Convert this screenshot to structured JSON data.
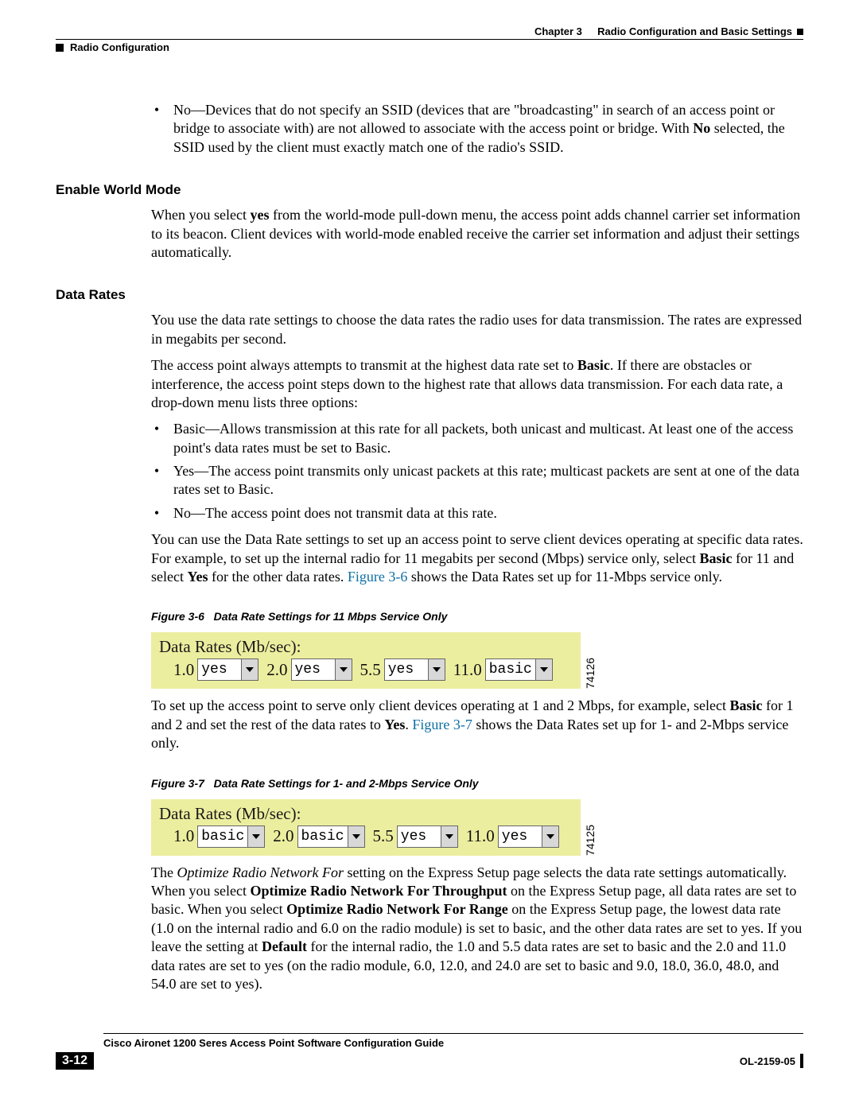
{
  "header": {
    "chapter_label": "Chapter 3",
    "chapter_title": "Radio Configuration and Basic Settings",
    "section_title": "Radio Configuration"
  },
  "intro_bullet": {
    "lead": "No—Devices that do not specify an SSID (devices that are \"broadcasting\" in search of an access point or bridge to associate with) are not allowed to associate with the access point or bridge. With ",
    "bold": "No",
    "tail": " selected, the SSID used by the client must exactly match one of the radio's SSID."
  },
  "sections": {
    "world_mode": {
      "heading": "Enable World Mode",
      "para": {
        "pre": "When you select ",
        "b1": "yes",
        "post": " from the world-mode pull-down menu, the access point adds channel carrier set information to its beacon. Client devices with world-mode enabled receive the carrier set information and adjust their settings automatically."
      }
    },
    "data_rates": {
      "heading": "Data Rates",
      "p1": "You use the data rate settings to choose the data rates the radio uses for data transmission. The rates are expressed in megabits per second.",
      "p2": {
        "pre": "The access point always attempts to transmit at the highest data rate set to ",
        "b": "Basic",
        "post": ". If there are obstacles or interference, the access point steps down to the highest rate that allows data transmission. For each data rate, a drop-down menu lists three options:"
      },
      "bullets": [
        "Basic—Allows transmission at this rate for all packets, both unicast and multicast. At least one of the access point's data rates must be set to Basic.",
        "Yes—The access point transmits only unicast packets at this rate; multicast packets are sent at one of the data rates set to Basic.",
        "No—The access point does not transmit data at this rate."
      ],
      "p3": {
        "pre": "You can use the Data Rate settings to set up an access point to serve client devices operating at specific data rates. For example, to set up the internal radio for 11 megabits per second (Mbps) service only, select ",
        "b1": "Basic",
        "mid1": " for 11 and select ",
        "b2": "Yes",
        "mid2": " for the other data rates. ",
        "link": "Figure 3-6",
        "tail": " shows the Data Rates set up for 11-Mbps service only."
      },
      "fig6": {
        "caption_num": "Figure 3-6",
        "caption_text": "Data Rate Settings for 11 Mbps Service Only",
        "title": "Data Rates  (Mb/sec):",
        "rates": [
          {
            "label": "1.0",
            "value": "yes"
          },
          {
            "label": "2.0",
            "value": "yes"
          },
          {
            "label": "5.5",
            "value": "yes"
          },
          {
            "label": "11.0",
            "value": "basic"
          }
        ],
        "code": "74126"
      },
      "p4": {
        "pre": "To set up the access point to serve only client devices operating at 1 and 2 Mbps, for example, select ",
        "b1": "Basic",
        "mid1": " for 1 and 2 and set the rest of the data rates to ",
        "b2": "Yes",
        "mid2": ". ",
        "link": "Figure 3-7",
        "tail": " shows the Data Rates set up for 1- and 2-Mbps service only."
      },
      "fig7": {
        "caption_num": "Figure 3-7",
        "caption_text": "Data Rate Settings for 1- and 2-Mbps Service Only",
        "title": "Data Rates  (Mb/sec):",
        "rates": [
          {
            "label": "1.0",
            "value": "basic"
          },
          {
            "label": "2.0",
            "value": "basic"
          },
          {
            "label": "5.5",
            "value": "yes"
          },
          {
            "label": "11.0",
            "value": "yes"
          }
        ],
        "code": "74125"
      },
      "p5": {
        "s1a": "The ",
        "i1": "Optimize Radio Network For",
        "s1b": " setting on the Express Setup page selects the data rate settings automatically. When you select ",
        "b1": "Optimize Radio Network For Throughput",
        "s2": " on the Express Setup page, all data rates are set to basic. When you select ",
        "b2": "Optimize Radio Network For Range",
        "s3": " on the Express Setup page, the lowest data rate (1.0 on the internal radio and 6.0 on the radio module) is set to basic, and the other data rates are set to yes. If you leave the setting at ",
        "b3": "Default",
        "s4": " for the internal radio, the 1.0 and 5.5 data rates are set to basic and the 2.0 and 11.0 data rates are set to yes (on the radio module, 6.0, 12.0, and 24.0 are set to basic and 9.0, 18.0, 36.0, 48.0, and 54.0 are set to yes)."
      }
    }
  },
  "footer": {
    "guide_title": "Cisco Aironet 1200 Seres Access Point Software Configuration Guide",
    "page_number": "3-12",
    "doc_number": "OL-2159-05"
  }
}
